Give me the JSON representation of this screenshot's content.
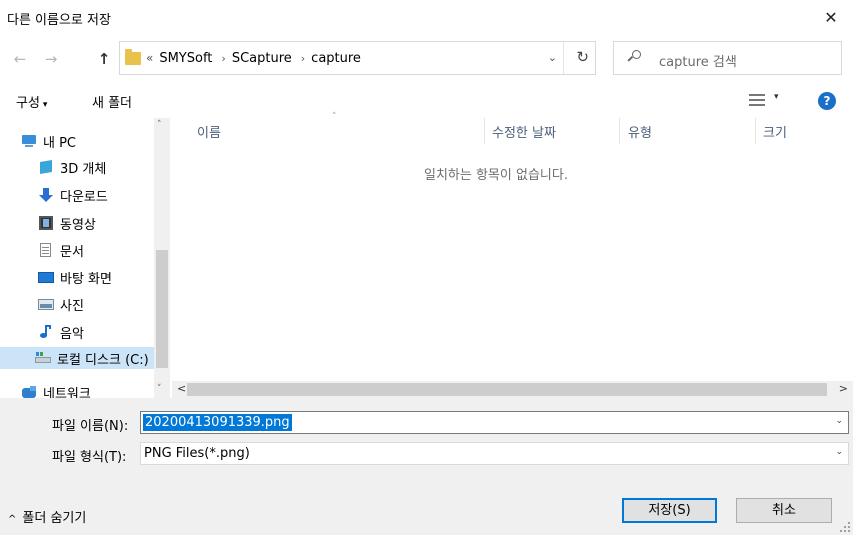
{
  "window": {
    "title": "다른 이름으로 저장",
    "close_glyph": "✕"
  },
  "nav": {
    "back_glyph": "←",
    "forward_glyph": "→",
    "up_glyph": "↑",
    "overflow_glyph": "«",
    "breadcrumbs": [
      "SMYSoft",
      "SCapture",
      "capture"
    ],
    "crumb_separator": "›",
    "dropdown_glyph": "⌄",
    "refresh_glyph": "↻"
  },
  "search": {
    "placeholder": "capture 검색"
  },
  "toolbar": {
    "organize_label": "구성",
    "organize_caret": "▾",
    "new_folder_label": "새 폴더",
    "view_caret": "▾",
    "help_glyph": "?"
  },
  "sidebar": {
    "items": [
      {
        "label": "내 PC",
        "icon": "computer-icon"
      },
      {
        "label": "3D 개체",
        "icon": "cube-icon"
      },
      {
        "label": "다운로드",
        "icon": "download-arrow-icon"
      },
      {
        "label": "동영상",
        "icon": "film-icon"
      },
      {
        "label": "문서",
        "icon": "document-icon"
      },
      {
        "label": "바탕 화면",
        "icon": "desktop-icon"
      },
      {
        "label": "사진",
        "icon": "picture-icon"
      },
      {
        "label": "음악",
        "icon": "music-note-icon"
      },
      {
        "label": "로컬 디스크 (C:)",
        "icon": "disk-drive-icon",
        "selected": true
      },
      {
        "label": "네트워크",
        "icon": "network-icon"
      }
    ],
    "scroll_up_glyph": "˄",
    "scroll_down_glyph": "˅"
  },
  "file_list": {
    "columns": [
      "이름",
      "수정한 날짜",
      "유형",
      "크기"
    ],
    "sort_glyph": "˄",
    "empty_message": "일치하는 항목이 없습니다.",
    "scroll_left_glyph": "<",
    "scroll_right_glyph": ">"
  },
  "form": {
    "filename_label": "파일 이름(N):",
    "filename_value": "20200413091339.png",
    "filetype_label": "파일 형식(T):",
    "filetype_value": "PNG Files(*.png)",
    "dropdown_glyph": "⌄"
  },
  "footer": {
    "hide_folders_label": "폴더 숨기기",
    "hide_folders_caret": "^",
    "save_label": "저장(S)",
    "cancel_label": "취소"
  },
  "colors": {
    "accent": "#0078d7",
    "selection": "#cce4f7",
    "header_text": "#4c607a"
  }
}
